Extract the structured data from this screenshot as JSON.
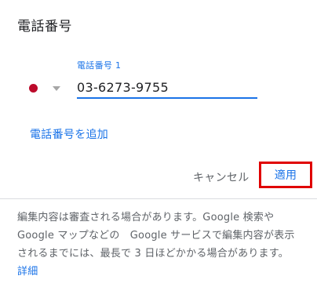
{
  "dialog": {
    "title": "電話番号",
    "phone": {
      "country_flag": "japan-flag-icon",
      "label": "電話番号 1",
      "value": "03-6273-9755"
    },
    "add_phone_label": "電話番号を追加",
    "cancel_label": "キャンセル",
    "apply_label": "適用",
    "highlight_color": "#e00000",
    "accent_color": "#1a73e8",
    "notice": {
      "text": "編集内容は審査される場合があります。Google 検索や Google マップなどの　Google サービスで編集内容が表示されるまでには、最長で 3 日ほどかかる場合があります。",
      "details_link": "詳細"
    }
  }
}
